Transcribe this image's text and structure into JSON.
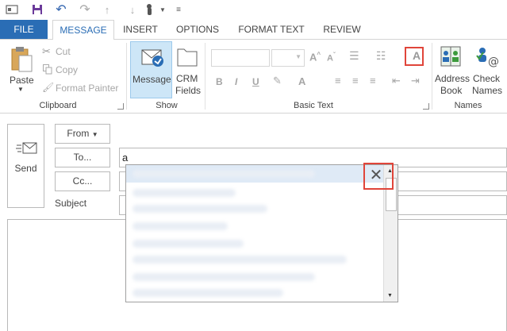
{
  "tabs": [
    "FILE",
    "MESSAGE",
    "INSERT",
    "OPTIONS",
    "FORMAT TEXT",
    "REVIEW"
  ],
  "clipboard": {
    "paste": "Paste",
    "cut": "Cut",
    "copy": "Copy",
    "format_painter": "Format Painter",
    "group": "Clipboard"
  },
  "show": {
    "message": "Message",
    "crm_line1": "CRM",
    "crm_line2": "Fields",
    "group": "Show"
  },
  "basic_text": {
    "group": "Basic Text"
  },
  "names": {
    "address_line1": "Address",
    "address_line2": "Book",
    "check_line1": "Check",
    "check_line2": "Names",
    "group": "Names"
  },
  "compose": {
    "send": "Send",
    "from": "From",
    "to": "To...",
    "cc": "Cc...",
    "subject_label": "Subject",
    "to_value": "a"
  },
  "colors": {
    "file_tab": "#2a6db5",
    "active_tab_text": "#2a6db5",
    "highlight": "#cde6f7",
    "callout_red": "#e0453a"
  },
  "icons": {
    "close": "close-icon",
    "dropdown": "chevron-down-icon"
  }
}
